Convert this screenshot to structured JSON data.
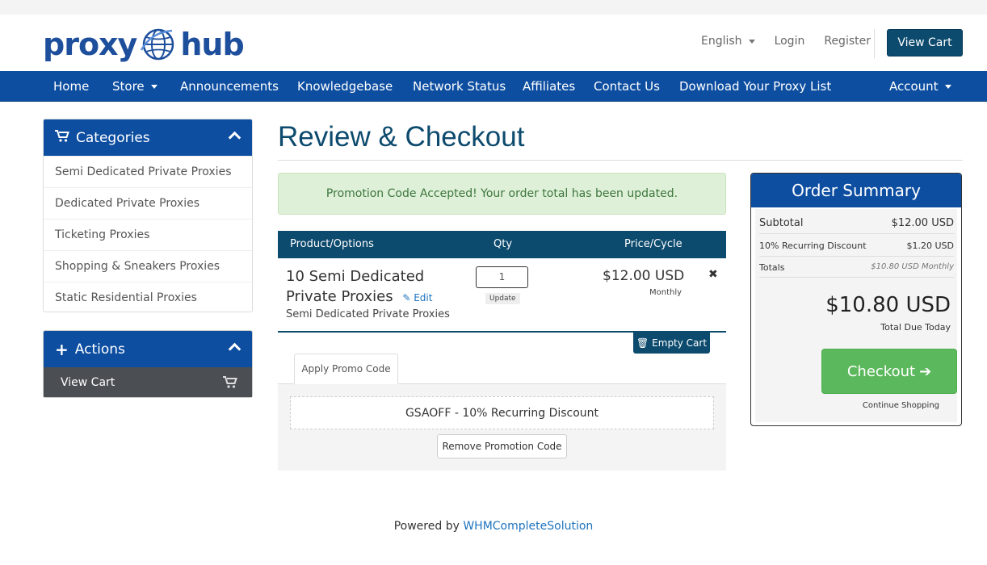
{
  "brand": {
    "word1": "proxy",
    "word2": "hub"
  },
  "header": {
    "language": "English",
    "login": "Login",
    "register": "Register",
    "view_cart": "View Cart"
  },
  "nav": {
    "items": [
      "Home",
      "Store",
      "Announcements",
      "Knowledgebase",
      "Network Status",
      "Affiliates",
      "Contact Us",
      "Download Your Proxy List"
    ],
    "account": "Account"
  },
  "sidebar": {
    "categories_title": "Categories",
    "categories": [
      "Semi Dedicated Private Proxies",
      "Dedicated Private Proxies",
      "Ticketing Proxies",
      "Shopping & Sneakers Proxies",
      "Static Residential Proxies"
    ],
    "actions_title": "Actions",
    "actions": [
      "View Cart"
    ]
  },
  "main": {
    "title": "Review & Checkout",
    "alert": "Promotion Code Accepted! Your order total has been updated.",
    "columns": {
      "product": "Product/Options",
      "qty": "Qty",
      "price": "Price/Cycle"
    },
    "item": {
      "name": "10 Semi Dedicated Private Proxies",
      "edit": "Edit",
      "group": "Semi Dedicated Private Proxies",
      "qty": "1",
      "update": "Update",
      "price": "$12.00 USD",
      "cycle": "Monthly"
    },
    "empty_cart": "Empty Cart",
    "promo_tab": "Apply Promo Code",
    "promo_applied": "GSAOFF - 10% Recurring Discount",
    "remove_promo": "Remove Promotion Code"
  },
  "summary": {
    "title": "Order Summary",
    "subtotal_label": "Subtotal",
    "subtotal_value": "$12.00 USD",
    "discount_label": "10% Recurring Discount",
    "discount_value": "$1.20 USD",
    "totals_label": "Totals",
    "totals_value": "$10.80 USD Monthly",
    "total_due": "$10.80 USD",
    "total_due_label": "Total Due Today",
    "checkout": "Checkout",
    "continue": "Continue Shopping"
  },
  "footer": {
    "prefix": "Powered by",
    "link": "WHMCompleteSolution"
  },
  "colors": {
    "primary": "#0d4ea1",
    "dark": "#0c4a6e",
    "success": "#5cb85c",
    "alert_bg": "#dff0d8"
  }
}
